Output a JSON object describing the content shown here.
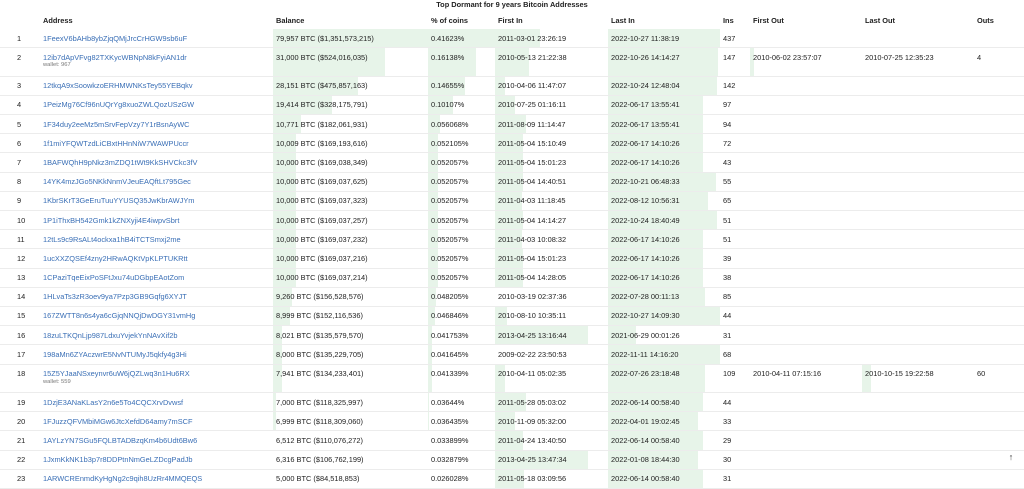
{
  "title": "Top Dormant for 9 years Bitcoin Addresses",
  "headers": {
    "num": "",
    "address": "Address",
    "balance": "Balance",
    "pct": "% of coins",
    "first_in": "First In",
    "last_in": "Last In",
    "ins": "Ins",
    "first_out": "First Out",
    "last_out": "Last Out",
    "outs": "Outs"
  },
  "scroll_top_icon": "up-arrow-icon",
  "colors": {
    "link": "#3a6fb6",
    "bar": "#e7f4e9"
  },
  "rows": [
    {
      "num": "1",
      "address": "1FeexV6bAHb8ybZjqQMjJrcCrHGW9sb6uF",
      "wallet": "",
      "balance": "79,957 BTC ($1,351,573,215)",
      "balance_fill": 1.0,
      "pct": "0.41623%",
      "pct_fill": 1.0,
      "first_in": "2011-03-01 23:26:19",
      "first_in_fill": 0.4,
      "last_in": "2022-10-27 11:38:19",
      "last_in_fill": 1.0,
      "ins": "437",
      "first_out": "",
      "last_out": "",
      "outs": ""
    },
    {
      "num": "2",
      "address": "12ib7dApVFvg82TXKycWBNpN8kFyiAN1dr",
      "wallet": "wallet: 967",
      "balance": "31,000 BTC ($524,016,035)",
      "balance_fill": 0.72,
      "pct": "0.16138%",
      "pct_fill": 0.72,
      "first_in": "2010-05-13 21:22:38",
      "first_in_fill": 0.3,
      "last_in": "2022-10-26 14:14:27",
      "last_in_fill": 0.98,
      "ins": "147",
      "first_out": "2010-06-02 23:57:07",
      "first_out_fill": 0.04,
      "last_out": "2010-07-25 12:35:23",
      "last_out_fill": 0.0,
      "outs": "4"
    },
    {
      "num": "3",
      "address": "12tkqA9xSoowkzoERHMWNKsTey55YEBqkv",
      "wallet": "",
      "balance": "28,151 BTC ($475,857,163)",
      "balance_fill": 0.55,
      "pct": "0.14655%",
      "pct_fill": 0.55,
      "first_in": "2010-04-06 11:47:07",
      "first_in_fill": 0.09,
      "last_in": "2022-10-24 12:48:04",
      "last_in_fill": 0.97,
      "ins": "142",
      "first_out": "",
      "last_out": "",
      "outs": ""
    },
    {
      "num": "4",
      "address": "1PeizMg76Cf96nUQrYg8xuoZWLQozUSzGW",
      "wallet": "",
      "balance": "19,414 BTC ($328,175,791)",
      "balance_fill": 0.38,
      "pct": "0.10107%",
      "pct_fill": 0.38,
      "first_in": "2010-07-25 01:16:11",
      "first_in_fill": 0.18,
      "last_in": "2022-06-17 13:55:41",
      "last_in_fill": 0.85,
      "ins": "97",
      "first_out": "",
      "last_out": "",
      "outs": ""
    },
    {
      "num": "5",
      "address": "1F34duy2eeMz5mSrvFepVzy7Y1rBsnAyWC",
      "wallet": "",
      "balance": "10,771 BTC ($182,061,931)",
      "balance_fill": 0.18,
      "pct": "0.056068%",
      "pct_fill": 0.18,
      "first_in": "2011-08-09 11:14:47",
      "first_in_fill": 0.27,
      "last_in": "2022-06-17 13:55:41",
      "last_in_fill": 0.85,
      "ins": "94",
      "first_out": "",
      "last_out": "",
      "outs": ""
    },
    {
      "num": "6",
      "address": "1f1miYFQWTzdLiCBxtHHnNiW7WAWPUccr",
      "wallet": "",
      "balance": "10,009 BTC ($169,193,616)",
      "balance_fill": 0.15,
      "pct": "0.052105%",
      "pct_fill": 0.15,
      "first_in": "2011-05-04 15:10:49",
      "first_in_fill": 0.25,
      "last_in": "2022-06-17 14:10:26",
      "last_in_fill": 0.85,
      "ins": "72",
      "first_out": "",
      "last_out": "",
      "outs": ""
    },
    {
      "num": "7",
      "address": "1BAFWQhH9pNkz3mZDQ1tWt9KkSHVCkc3fV",
      "wallet": "",
      "balance": "10,000 BTC ($169,038,349)",
      "balance_fill": 0.15,
      "pct": "0.052057%",
      "pct_fill": 0.15,
      "first_in": "2011-05-04 15:01:23",
      "first_in_fill": 0.25,
      "last_in": "2022-06-17 14:10:26",
      "last_in_fill": 0.85,
      "ins": "43",
      "first_out": "",
      "last_out": "",
      "outs": ""
    },
    {
      "num": "8",
      "address": "14YK4mzJGo5NKkNnmVJeuEAQftLt795Gec",
      "wallet": "",
      "balance": "10,000 BTC ($169,037,625)",
      "balance_fill": 0.15,
      "pct": "0.052057%",
      "pct_fill": 0.15,
      "first_in": "2011-05-04 14:40:51",
      "first_in_fill": 0.25,
      "last_in": "2022-10-21 06:48:33",
      "last_in_fill": 0.96,
      "ins": "55",
      "first_out": "",
      "last_out": "",
      "outs": ""
    },
    {
      "num": "9",
      "address": "1KbrSKrT3GeEruTuuYYUSQ35JwKbrAWJYm",
      "wallet": "",
      "balance": "10,000 BTC ($169,037,323)",
      "balance_fill": 0.15,
      "pct": "0.052057%",
      "pct_fill": 0.15,
      "first_in": "2011-04-03 11:18:45",
      "first_in_fill": 0.24,
      "last_in": "2022-08-12 10:56:31",
      "last_in_fill": 0.89,
      "ins": "65",
      "first_out": "",
      "last_out": "",
      "outs": ""
    },
    {
      "num": "10",
      "address": "1P1iThxBH542Gmk1kZNXyji4E4iwpvSbrt",
      "wallet": "",
      "balance": "10,000 BTC ($169,037,257)",
      "balance_fill": 0.15,
      "pct": "0.052057%",
      "pct_fill": 0.15,
      "first_in": "2011-05-04 14:14:27",
      "first_in_fill": 0.25,
      "last_in": "2022-10-24 18:40:49",
      "last_in_fill": 0.97,
      "ins": "51",
      "first_out": "",
      "last_out": "",
      "outs": ""
    },
    {
      "num": "11",
      "address": "12tLs9c9RsALt4ockxa1hB4iTCTSmxj2me",
      "wallet": "",
      "balance": "10,000 BTC ($169,037,232)",
      "balance_fill": 0.15,
      "pct": "0.052057%",
      "pct_fill": 0.15,
      "first_in": "2011-04-03 10:08:32",
      "first_in_fill": 0.24,
      "last_in": "2022-06-17 14:10:26",
      "last_in_fill": 0.85,
      "ins": "51",
      "first_out": "",
      "last_out": "",
      "outs": ""
    },
    {
      "num": "12",
      "address": "1ucXXZQSEf4zny2HRwAQKtVpKLPTUKRtt",
      "wallet": "",
      "balance": "10,000 BTC ($169,037,216)",
      "balance_fill": 0.15,
      "pct": "0.052057%",
      "pct_fill": 0.15,
      "first_in": "2011-05-04 15:01:23",
      "first_in_fill": 0.25,
      "last_in": "2022-06-17 14:10:26",
      "last_in_fill": 0.85,
      "ins": "39",
      "first_out": "",
      "last_out": "",
      "outs": ""
    },
    {
      "num": "13",
      "address": "1CPaziTqeEixPoSFtJxu74uDGbpEAotZom",
      "wallet": "",
      "balance": "10,000 BTC ($169,037,214)",
      "balance_fill": 0.15,
      "pct": "0.052057%",
      "pct_fill": 0.15,
      "first_in": "2011-05-04 14:28:05",
      "first_in_fill": 0.25,
      "last_in": "2022-06-17 14:10:26",
      "last_in_fill": 0.85,
      "ins": "38",
      "first_out": "",
      "last_out": "",
      "outs": ""
    },
    {
      "num": "14",
      "address": "1HLvaTs3zR3oev9ya7Pzp3GB9Gqfg6XYJT",
      "wallet": "",
      "balance": "9,260 BTC ($156,528,576)",
      "balance_fill": 0.12,
      "pct": "0.048205%",
      "pct_fill": 0.12,
      "first_in": "2010-03-19 02:37:36",
      "first_in_fill": 0.0,
      "last_in": "2022-07-28 00:11:13",
      "last_in_fill": 0.87,
      "ins": "85",
      "first_out": "",
      "last_out": "",
      "outs": ""
    },
    {
      "num": "15",
      "address": "167ZWTT8n6s4ya6cGjqNNQjDwDGY31vmHg",
      "wallet": "",
      "balance": "8,999 BTC ($152,116,536)",
      "balance_fill": 0.11,
      "pct": "0.046846%",
      "pct_fill": 0.11,
      "first_in": "2010-08-10 10:35:11",
      "first_in_fill": 0.11,
      "last_in": "2022-10-27 14:09:30",
      "last_in_fill": 1.0,
      "ins": "44",
      "first_out": "",
      "last_out": "",
      "outs": ""
    },
    {
      "num": "16",
      "address": "18zuLTKQnLjp987LdxuYvjekYnNAvXif2b",
      "wallet": "",
      "balance": "8,021 BTC ($135,579,570)",
      "balance_fill": 0.06,
      "pct": "0.041753%",
      "pct_fill": 0.06,
      "first_in": "2013-04-25 13:16:44",
      "first_in_fill": 0.82,
      "last_in": "2021-06-29 00:01:26",
      "last_in_fill": 0.25,
      "ins": "31",
      "first_out": "",
      "last_out": "",
      "outs": ""
    },
    {
      "num": "17",
      "address": "198aMn6ZYAczwrE5NvNTUMyJ5qkfy4g3Hi",
      "wallet": "",
      "balance": "8,000 BTC ($135,229,705)",
      "balance_fill": 0.06,
      "pct": "0.041645%",
      "pct_fill": 0.06,
      "first_in": "2009-02-22 23:50:53",
      "first_in_fill": 0.0,
      "last_in": "2022-11-11 14:16:20",
      "last_in_fill": 1.0,
      "ins": "68",
      "first_out": "",
      "last_out": "",
      "outs": ""
    },
    {
      "num": "18",
      "address": "15Z5YJaaNSxeynvr6uW6jQZLwq3n1Hu6RX",
      "wallet": "wallet: 559",
      "balance": "7,941 BTC ($134,233,401)",
      "balance_fill": 0.06,
      "pct": "0.041339%",
      "pct_fill": 0.06,
      "first_in": "2010-04-11 05:02:35",
      "first_in_fill": 0.09,
      "last_in": "2022-07-26 23:18:48",
      "last_in_fill": 0.87,
      "ins": "109",
      "first_out": "2010-04-11 07:15:16",
      "first_out_fill": 0.0,
      "last_out": "2010-10-15 19:22:58",
      "last_out_fill": 0.08,
      "outs": "60"
    },
    {
      "num": "19",
      "address": "1DzjE3ANaKLasY2n6e5To4CQCXrvDvwsf",
      "wallet": "",
      "balance": "7,000 BTC ($118,325,997)",
      "balance_fill": 0.02,
      "pct": "0.03644%",
      "pct_fill": 0.02,
      "first_in": "2011-05-28 05:03:02",
      "first_in_fill": 0.27,
      "last_in": "2022-06-14 00:58:40",
      "last_in_fill": 0.85,
      "ins": "44",
      "first_out": "",
      "last_out": "",
      "outs": ""
    },
    {
      "num": "20",
      "address": "1FJuzzQFVMbiMGw6JtcXefdD64amy7mSCF",
      "wallet": "",
      "balance": "6,999 BTC ($118,309,060)",
      "balance_fill": 0.02,
      "pct": "0.036435%",
      "pct_fill": 0.02,
      "first_in": "2010-11-09 05:32:00",
      "first_in_fill": 0.18,
      "last_in": "2022-04-01 19:02:45",
      "last_in_fill": 0.8,
      "ins": "33",
      "first_out": "",
      "last_out": "",
      "outs": ""
    },
    {
      "num": "21",
      "address": "1AYLzYN7SGu5FQLBTADBzqKm4b6Udt6Bw6",
      "wallet": "",
      "balance": "6,512 BTC ($110,076,272)",
      "balance_fill": 0.0,
      "pct": "0.033899%",
      "pct_fill": 0.0,
      "first_in": "2011-04-24 13:40:50",
      "first_in_fill": 0.25,
      "last_in": "2022-06-14 00:58:40",
      "last_in_fill": 0.85,
      "ins": "29",
      "first_out": "",
      "last_out": "",
      "outs": ""
    },
    {
      "num": "22",
      "address": "1JxmKkNK1b3p7r8DDPtnNmGeLZDcgPadJb",
      "wallet": "",
      "balance": "6,316 BTC ($106,762,199)",
      "balance_fill": 0.0,
      "pct": "0.032879%",
      "pct_fill": 0.0,
      "first_in": "2013-04-25 13:47:34",
      "first_in_fill": 0.82,
      "last_in": "2022-01-08 18:44:30",
      "last_in_fill": 0.8,
      "ins": "30",
      "first_out": "",
      "last_out": "",
      "outs": ""
    },
    {
      "num": "23",
      "address": "1ARWCREnmdKyHgNg2c9qih8UzRr4MMQEQS",
      "wallet": "",
      "balance": "5,000 BTC ($84,518,853)",
      "balance_fill": 0.0,
      "pct": "0.026028%",
      "pct_fill": 0.0,
      "first_in": "2011-05-18 03:09:56",
      "first_in_fill": 0.26,
      "last_in": "2022-06-14 00:58:40",
      "last_in_fill": 0.85,
      "ins": "31",
      "first_out": "",
      "last_out": "",
      "outs": ""
    }
  ]
}
